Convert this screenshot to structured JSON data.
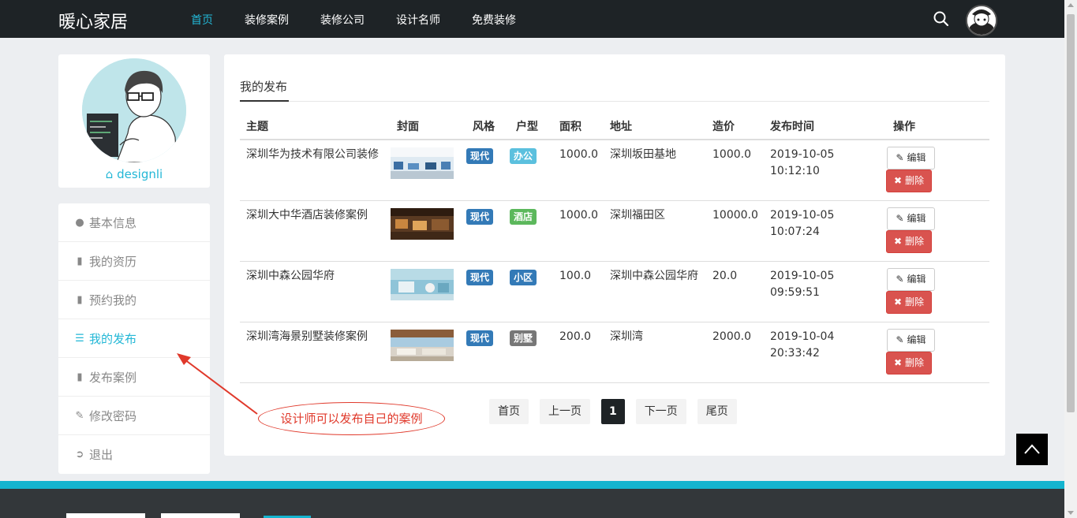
{
  "header": {
    "brand": "暖心家居",
    "nav": [
      "首页",
      "装修案例",
      "装修公司",
      "设计名师",
      "免费装修"
    ],
    "active_nav": "首页"
  },
  "profile": {
    "username": "designli"
  },
  "side_menu": [
    {
      "icon": "user-icon",
      "label": "基本信息"
    },
    {
      "icon": "book-icon",
      "label": "我的资历"
    },
    {
      "icon": "book-icon",
      "label": "预约我的"
    },
    {
      "icon": "list-icon",
      "label": "我的发布",
      "active": true
    },
    {
      "icon": "book-icon",
      "label": "发布案例"
    },
    {
      "icon": "edit-icon",
      "label": "修改密码"
    },
    {
      "icon": "sign-out-icon",
      "label": "退出"
    }
  ],
  "main": {
    "tab": "我的发布",
    "columns": [
      "主题",
      "封面",
      "风格",
      "户型",
      "面积",
      "地址",
      "造价",
      "发布时间",
      "操作"
    ],
    "rows": [
      {
        "title": "深圳华为技术有限公司装修",
        "style": "现代",
        "type": "办公",
        "type_color": "info",
        "area": "1000.0",
        "address": "深圳坂田基地",
        "price": "1000.0",
        "date": "2019-10-05",
        "time": "10:12:10"
      },
      {
        "title": "深圳大中华酒店装修案例",
        "style": "现代",
        "type": "酒店",
        "type_color": "green",
        "area": "1000.0",
        "address": "深圳福田区",
        "price": "10000.0",
        "date": "2019-10-05",
        "time": "10:07:24"
      },
      {
        "title": "深圳中森公园华府",
        "style": "现代",
        "type": "小区",
        "type_color": "blue",
        "area": "100.0",
        "address": "深圳中森公园华府",
        "price": "20.0",
        "date": "2019-10-05",
        "time": "09:59:51"
      },
      {
        "title": "深圳湾海景别墅装修案例",
        "style": "现代",
        "type": "别墅",
        "type_color": "gray",
        "area": "200.0",
        "address": "深圳湾",
        "price": "2000.0",
        "date": "2019-10-04",
        "time": "20:33:42"
      }
    ],
    "edit_label": "编辑",
    "delete_label": "删除"
  },
  "pager": {
    "first": "首页",
    "prev": "上一页",
    "current": "1",
    "next": "下一页",
    "last": "尾页"
  },
  "annotation": "设计师可以发布自己的案例"
}
